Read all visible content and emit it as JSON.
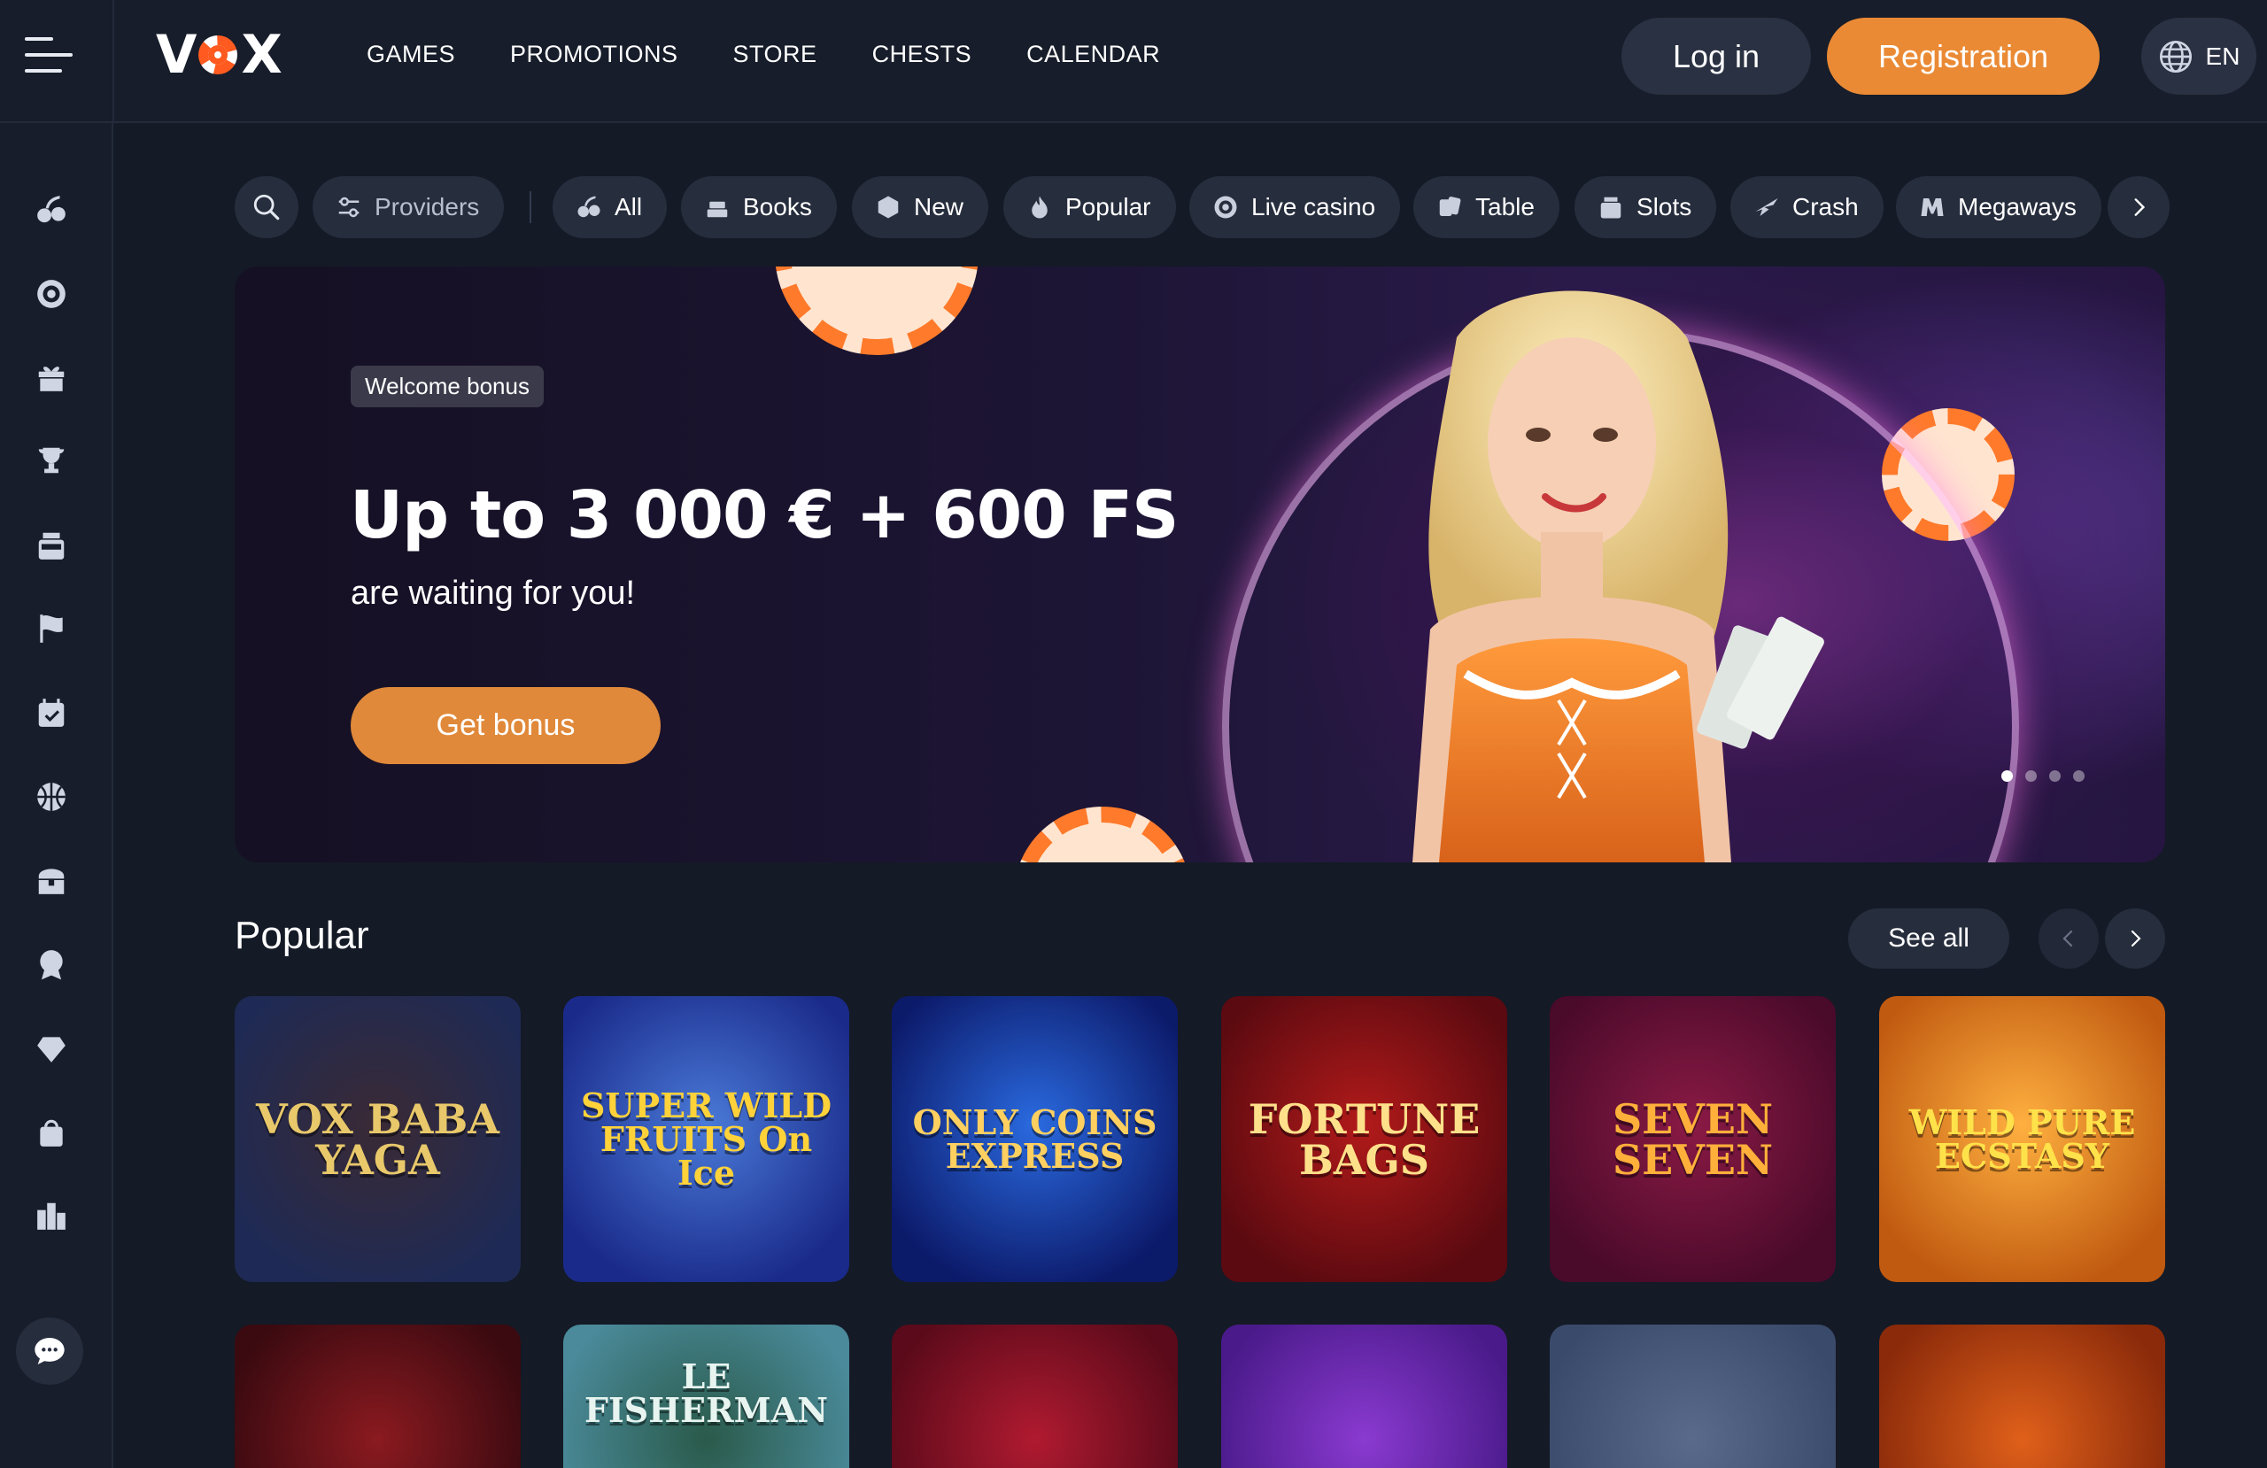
{
  "header": {
    "logo": "VOX",
    "nav": [
      "GAMES",
      "PROMOTIONS",
      "STORE",
      "CHESTS",
      "CALENDAR"
    ],
    "login_label": "Log in",
    "register_label": "Registration",
    "language": "EN"
  },
  "sidebar": {
    "icons": [
      "cherries-icon",
      "live-casino-icon",
      "gift-icon",
      "trophy-icon",
      "slot-machine-icon",
      "flag-icon",
      "calendar-icon",
      "basketball-icon",
      "treasure-chest-icon",
      "badge-icon",
      "diamond-icon",
      "bag-icon",
      "leaderboard-icon"
    ],
    "chat_icon": "chat-icon"
  },
  "filters": {
    "providers": "Providers",
    "categories": [
      {
        "label": "All",
        "icon": "cherries-icon"
      },
      {
        "label": "Books",
        "icon": "books-icon"
      },
      {
        "label": "New",
        "icon": "cube-icon"
      },
      {
        "label": "Popular",
        "icon": "fire-icon"
      },
      {
        "label": "Live casino",
        "icon": "live-casino-icon"
      },
      {
        "label": "Table",
        "icon": "cards-icon"
      },
      {
        "label": "Slots",
        "icon": "slot-machine-icon"
      },
      {
        "label": "Crash",
        "icon": "plane-icon"
      },
      {
        "label": "Megaways",
        "icon": "megaways-icon"
      }
    ]
  },
  "banner": {
    "badge": "Welcome bonus",
    "title": "Up to 3 000 € + 600 FS",
    "subtitle": "are waiting for you!",
    "cta": "Get bonus",
    "slides": 4,
    "active_slide": 1
  },
  "popular": {
    "title": "Popular",
    "see_all": "See all",
    "games_row1": [
      {
        "name": "VOX BABA YAGA",
        "bg1": "#1e2a55",
        "bg2": "#3a2a35",
        "fg": "#e8c86a"
      },
      {
        "name": "SUPER WILD FRUITS On Ice",
        "bg1": "#1a2a8a",
        "bg2": "#4a7ad8",
        "fg": "#ffd23a"
      },
      {
        "name": "ONLY COINS EXPRESS",
        "bg1": "#0c1a6a",
        "bg2": "#2a6ae0",
        "fg": "#ffd060"
      },
      {
        "name": "FORTUNE BAGS",
        "bg1": "#5a0a10",
        "bg2": "#b21a1a",
        "fg": "#ffe08a"
      },
      {
        "name": "SEVEN SEVEN",
        "bg1": "#4a0a2a",
        "bg2": "#8a1a45",
        "fg": "#ffb03a"
      },
      {
        "name": "WILD PURE ECSTASY",
        "bg1": "#c05a10",
        "bg2": "#ffb040",
        "fg": "#ffe24a"
      }
    ],
    "games_row2": [
      {
        "name": "",
        "bg1": "#3a0a10",
        "bg2": "#8a1a20"
      },
      {
        "name": "LE FISHERMAN",
        "bg1": "#4a8a9a",
        "bg2": "#2a5a4a"
      },
      {
        "name": "",
        "bg1": "#5a0a1a",
        "bg2": "#b01a30"
      },
      {
        "name": "",
        "bg1": "#4a1a8a",
        "bg2": "#8a3ad0"
      },
      {
        "name": "",
        "bg1": "#3a4a6a",
        "bg2": "#5a6a8a"
      },
      {
        "name": "",
        "bg1": "#8a2a0a",
        "bg2": "#e0601a"
      }
    ]
  }
}
